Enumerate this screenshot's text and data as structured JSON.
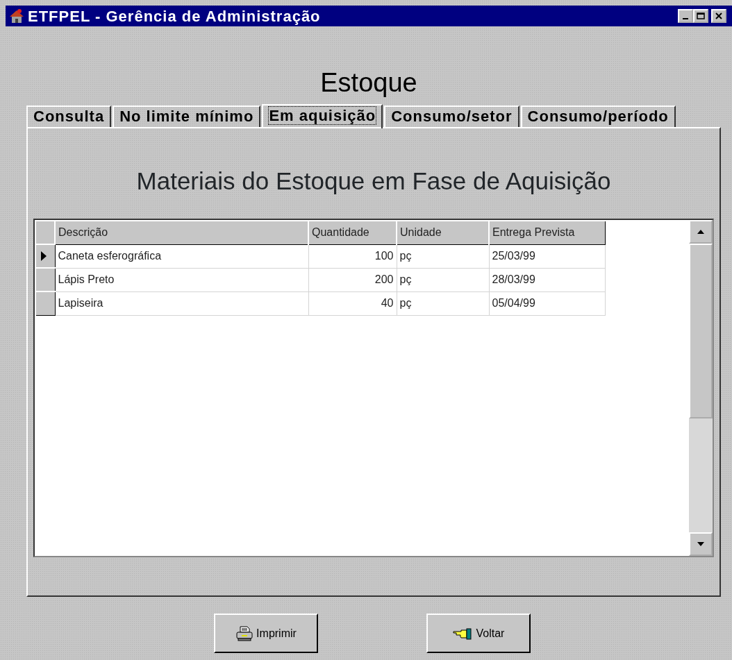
{
  "window": {
    "title": "ETFPEL - Gerência de Administração"
  },
  "heading": "Estoque",
  "tabs": [
    {
      "label": "Consulta",
      "selected": false
    },
    {
      "label": "No limite mínimo",
      "selected": false
    },
    {
      "label": "Em aquisição",
      "selected": true
    },
    {
      "label": "Consumo/setor",
      "selected": false
    },
    {
      "label": "Consumo/período",
      "selected": false
    }
  ],
  "panel_title": "Materiais do Estoque em Fase de Aquisição",
  "table": {
    "columns": [
      "Descrição",
      "Quantidade",
      "Unidade",
      "Entrega Prevista"
    ],
    "rows": [
      {
        "cells": [
          "Caneta esferográfica",
          "100",
          "pç",
          "25/03/99"
        ],
        "selected": true
      },
      {
        "cells": [
          "Lápis Preto",
          "200",
          "pç",
          "28/03/99"
        ],
        "selected": false
      },
      {
        "cells": [
          "Lapiseira",
          "40",
          "pç",
          "05/04/99"
        ],
        "selected": false
      }
    ]
  },
  "buttons": [
    {
      "label": "Imprimir",
      "kind": "print"
    },
    {
      "label": "Voltar",
      "kind": "back"
    }
  ]
}
